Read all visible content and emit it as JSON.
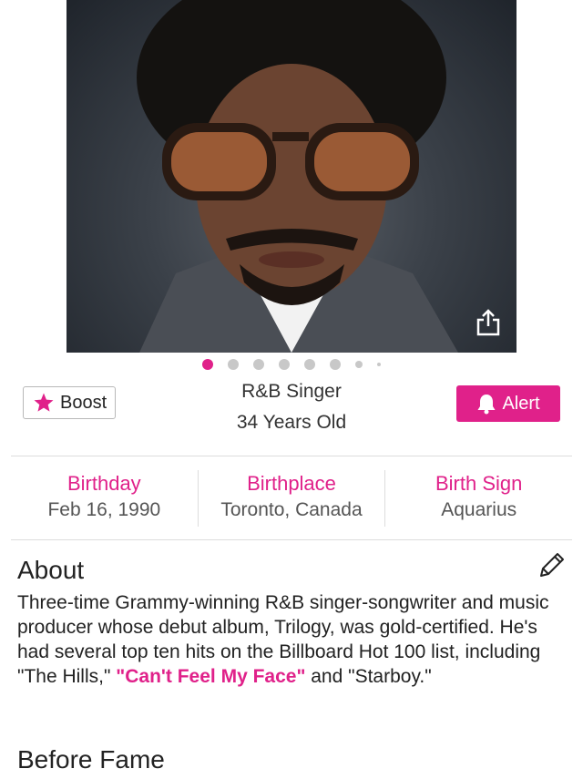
{
  "profile": {
    "role": "R&B Singer",
    "age": "34 Years Old"
  },
  "buttons": {
    "boost": "Boost",
    "alert": "Alert"
  },
  "facts": [
    {
      "label": "Birthday",
      "value": "Feb 16, 1990"
    },
    {
      "label": "Birthplace",
      "value": "Toronto, Canada"
    },
    {
      "label": "Birth Sign",
      "value": "Aquarius"
    }
  ],
  "about": {
    "title": "About",
    "text_before": "Three-time Grammy-winning R&B singer-songwriter and music producer whose debut album, Trilogy, was gold-certified. He's had several top ten hits on the Billboard Hot 100 list, including \"The Hills,\" ",
    "highlight": "\"Can't Feel My Face\"",
    "text_after": " and \"Starboy.\""
  },
  "before_fame": {
    "title": "Before Fame"
  },
  "carousel": {
    "active_index": 0,
    "dots": 8
  },
  "colors": {
    "accent": "#e0218a"
  },
  "icons": [
    "share-icon",
    "star-icon",
    "bell-icon",
    "pencil-icon"
  ]
}
